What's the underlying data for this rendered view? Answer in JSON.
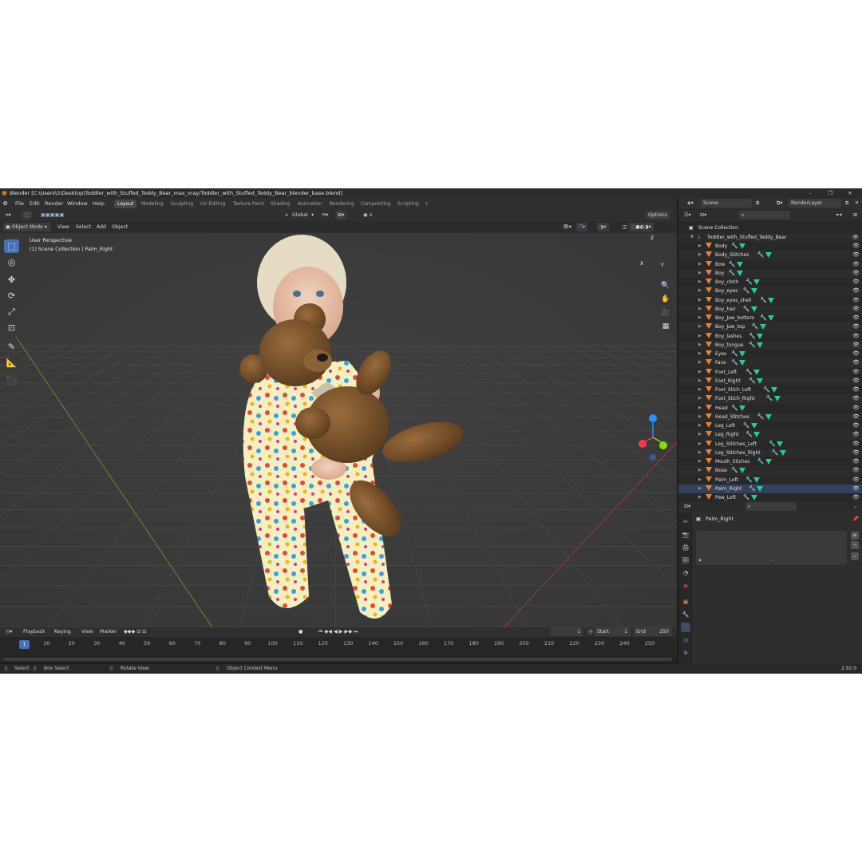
{
  "window": {
    "title": "Blender [C:\\Users\\5\\Desktop\\Toddler_with_Stuffed_Teddy_Bear_max_vray/Toddler_with_Stuffed_Teddy_Bear_blender_base.blend]"
  },
  "menu": [
    "File",
    "Edit",
    "Render",
    "Window",
    "Help"
  ],
  "workspaces": [
    "Layout",
    "Modeling",
    "Sculpting",
    "UV Editing",
    "Texture Paint",
    "Shading",
    "Animation",
    "Rendering",
    "Compositing",
    "Scripting"
  ],
  "active_workspace": "Layout",
  "header": {
    "scene": "Scene",
    "render_layer": "RenderLayer"
  },
  "viewport": {
    "mode": "Object Mode",
    "menus": [
      "View",
      "Select",
      "Add",
      "Object"
    ],
    "transform_orientation": "Global",
    "options_label": "Options",
    "info_line1": "User Perspective",
    "info_line2": "(1) Scene Collection | Palm_Right",
    "gizmo": {
      "z": "Z",
      "y": "Y",
      "x": "X"
    }
  },
  "timeline": {
    "menus": [
      "Playback",
      "Keying",
      "View",
      "Marker"
    ],
    "current_frame": "1",
    "start_label": "Start",
    "start": "1",
    "end_label": "End",
    "end": "250",
    "ruler": [
      "1",
      "10",
      "20",
      "30",
      "40",
      "50",
      "60",
      "70",
      "80",
      "90",
      "100",
      "110",
      "120",
      "130",
      "140",
      "150",
      "160",
      "170",
      "180",
      "190",
      "200",
      "210",
      "220",
      "230",
      "240",
      "250"
    ],
    "ruler_values": [
      1,
      10,
      20,
      30,
      40,
      50,
      60,
      70,
      80,
      90,
      100,
      110,
      120,
      130,
      140,
      150,
      160,
      170,
      180,
      190,
      200,
      210,
      220,
      230,
      240,
      250
    ]
  },
  "outliner": {
    "scene_collection": "Scene Collection",
    "root": "Toddler_with_Stuffed_Teddy_Bear",
    "items": [
      "Body",
      "Body_Stitches",
      "Bow",
      "Boy",
      "Boy_cloth",
      "Boy_eyes",
      "Boy_eyes_shell",
      "Boy_hair",
      "Boy_Jaw_bottom",
      "Boy_Jaw_top",
      "Boy_lashes",
      "Boy_tongue",
      "Eyes",
      "Face",
      "Foot_Left",
      "Foot_Right",
      "Foot_Stich_Left",
      "Foot_Stich_Right",
      "Head",
      "Head_Stitches",
      "Leg_Left",
      "Leg_Right",
      "Leg_Stitches_Left",
      "Leg_Stitches_Right",
      "Mouth_Stiches",
      "Nose",
      "Palm_Left",
      "Palm_Right",
      "Paw_Left"
    ],
    "selected": "Palm_Right"
  },
  "properties": {
    "object_name": "Palm_Right"
  },
  "status": {
    "select": "Select",
    "box_select": "Box Select",
    "rotate_view": "Rotate View",
    "context_menu": "Object Context Menu",
    "version": "2.92.0"
  },
  "colors": {
    "accent": "#4772b3",
    "mesh_icon": "#e7823a",
    "modifier_icon": "#2fc79b",
    "x_axis": "#ff3352",
    "y_axis": "#8bdc00",
    "z_axis": "#2890ff"
  }
}
